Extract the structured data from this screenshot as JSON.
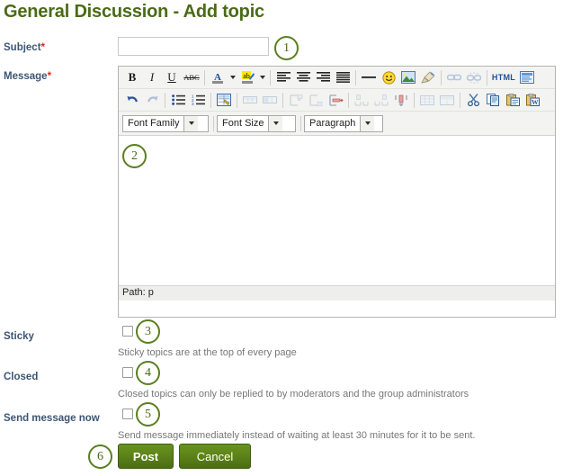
{
  "page": {
    "title": "General Discussion - Add topic"
  },
  "form": {
    "subject": {
      "label": "Subject",
      "required_mark": "*",
      "value": "",
      "placeholder": ""
    },
    "message": {
      "label": "Message",
      "required_mark": "*",
      "value": "",
      "path_status": "Path: p"
    },
    "sticky": {
      "label": "Sticky",
      "checked": false,
      "help": "Sticky topics are at the top of every page"
    },
    "closed": {
      "label": "Closed",
      "checked": false,
      "help": "Closed topics can only be replied to by moderators and the group administrators"
    },
    "send_message_now": {
      "label": "Send message now",
      "checked": false,
      "help": "Send message immediately instead of waiting at least 30 minutes for it to be sent."
    }
  },
  "editor": {
    "row1": [
      {
        "name": "bold-icon",
        "glyph": "B",
        "disabled": false
      },
      {
        "name": "italic-icon",
        "glyph": "I",
        "disabled": false
      },
      {
        "name": "underline-icon",
        "glyph": "U",
        "disabled": false
      },
      {
        "name": "strikethrough-icon",
        "glyph": "ABC",
        "disabled": false
      },
      {
        "name": "text-color-icon",
        "glyph": "A",
        "disabled": false
      },
      {
        "name": "background-color-icon",
        "glyph": "ab",
        "disabled": false
      },
      {
        "name": "align-left-icon",
        "glyph": "",
        "disabled": false
      },
      {
        "name": "align-center-icon",
        "glyph": "",
        "disabled": false
      },
      {
        "name": "align-right-icon",
        "glyph": "",
        "disabled": false
      },
      {
        "name": "align-justify-icon",
        "glyph": "",
        "disabled": false
      },
      {
        "name": "horizontal-rule-icon",
        "glyph": "",
        "disabled": false
      },
      {
        "name": "emoticon-icon",
        "glyph": "",
        "disabled": false
      },
      {
        "name": "insert-image-icon",
        "glyph": "",
        "disabled": false
      },
      {
        "name": "clean-formatting-icon",
        "glyph": "",
        "disabled": false
      },
      {
        "name": "insert-link-icon",
        "glyph": "",
        "disabled": true
      },
      {
        "name": "unlink-icon",
        "glyph": "",
        "disabled": true
      },
      {
        "name": "edit-html-icon",
        "glyph": "HTML",
        "disabled": false
      },
      {
        "name": "fullscreen-icon",
        "glyph": "",
        "disabled": false
      }
    ],
    "row2": [
      {
        "name": "undo-icon",
        "disabled": false
      },
      {
        "name": "redo-icon",
        "disabled": true
      },
      {
        "name": "bullet-list-icon",
        "disabled": false
      },
      {
        "name": "numbered-list-icon",
        "disabled": false
      },
      {
        "name": "insert-table-icon",
        "disabled": false
      },
      {
        "name": "table-row-properties-icon",
        "disabled": true
      },
      {
        "name": "table-cell-properties-icon",
        "disabled": true
      },
      {
        "name": "insert-row-before-icon",
        "disabled": true
      },
      {
        "name": "insert-row-after-icon",
        "disabled": true
      },
      {
        "name": "delete-row-icon",
        "disabled": true
      },
      {
        "name": "insert-column-before-icon",
        "disabled": true
      },
      {
        "name": "insert-column-after-icon",
        "disabled": true
      },
      {
        "name": "delete-column-icon",
        "disabled": false
      },
      {
        "name": "split-cells-icon",
        "disabled": true
      },
      {
        "name": "merge-cells-icon",
        "disabled": true
      },
      {
        "name": "cut-icon",
        "disabled": false
      },
      {
        "name": "copy-icon",
        "disabled": false
      },
      {
        "name": "paste-icon",
        "disabled": false
      },
      {
        "name": "paste-from-word-icon",
        "disabled": false
      }
    ],
    "selects": {
      "font_family": "Font Family",
      "font_size": "Font Size",
      "paragraph": "Paragraph"
    }
  },
  "actions": {
    "post": "Post",
    "cancel": "Cancel"
  },
  "markers": {
    "m1": "1",
    "m2": "2",
    "m3": "3",
    "m4": "4",
    "m5": "5",
    "m6": "6"
  },
  "colors": {
    "heading_green": "#4a6b16",
    "label_blue": "#3b5675",
    "required_red": "#d52b1e",
    "button_green": "#5d8419",
    "marker_green": "#5b7f1e",
    "help_gray": "#777777"
  }
}
